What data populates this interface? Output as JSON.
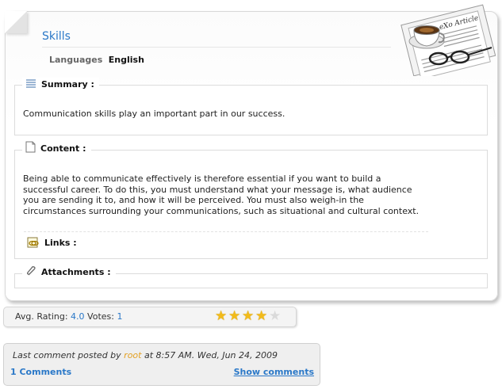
{
  "article": {
    "title": "Skills",
    "language_label": "Languages",
    "language_value": "English",
    "badge": "eXo Article"
  },
  "summary": {
    "label": "Summary :",
    "text": "Communication skills play an important part in our success."
  },
  "content": {
    "label": "Content :",
    "lines": [
      "Being able to communicate effectively is therefore essential if you want to build a",
      "successful career. To do this, you must understand what your message is, what audience",
      "you are sending it to, and how it will be perceived. You must also weigh-in the",
      "circumstances surrounding your communications, such as situational and cultural context."
    ]
  },
  "links": {
    "label": "Links :"
  },
  "attachments": {
    "label": "Attachments :"
  },
  "rating": {
    "avg_label": "Avg. Rating:",
    "avg_value": "4.0",
    "votes_label": "Votes:",
    "votes_value": "1",
    "stars_filled": 4,
    "stars_total": 5,
    "star_color": "#f2bb1a"
  },
  "comment": {
    "prefix": "Last comment posted by",
    "author": "root",
    "suffix": "at 8:57 AM. Wed, Jun 24, 2009",
    "count": "1 Comments",
    "show_label": "Show comments"
  },
  "colors": {
    "accent": "#2a78c8",
    "author": "#e3a022"
  }
}
